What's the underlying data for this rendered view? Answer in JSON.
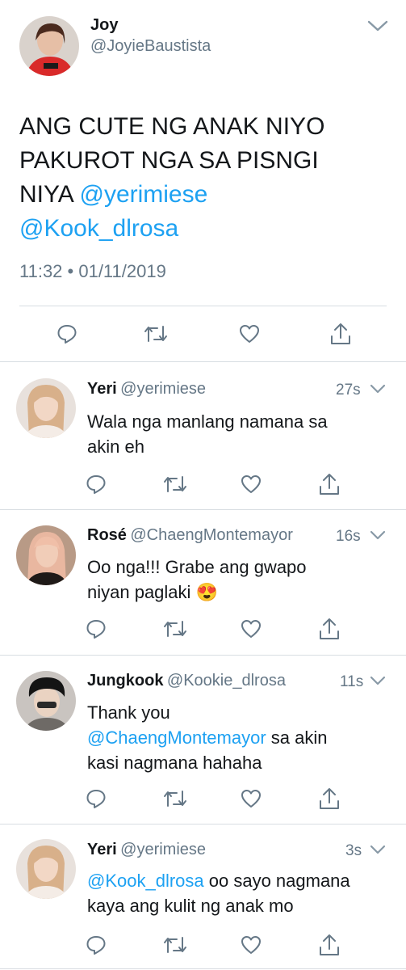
{
  "main_tweet": {
    "name": "Joy",
    "handle": "@JoyieBaustista",
    "text_line1": "ANG CUTE NG ANAK NIYO",
    "text_line2": "PAKUROT NGA SA PISNGI",
    "text_line3_prefix": "NIYA ",
    "mention1": "@yerimiese",
    "mention2": "@Kook_dlrosa",
    "timestamp": "11:32 • 01/11/2019"
  },
  "replies": [
    {
      "name": "Yeri",
      "handle": "@yerimiese",
      "time": "27s",
      "line1": "Wala nga manlang namana sa",
      "line2": "akin eh"
    },
    {
      "name": "Rosé",
      "handle": "@ChaengMontemayor",
      "time": "16s",
      "line1": "Oo nga!!! Grabe ang gwapo",
      "line2": "niyan paglaki",
      "emoji": "😍"
    },
    {
      "name": "Jungkook",
      "handle": "@Kookie_dlrosa",
      "time": "11s",
      "line1": "Thank you",
      "mention": "@ChaengMontemayor",
      "line2_suffix": " sa akin",
      "line3": "kasi nagmana hahaha"
    },
    {
      "name": "Yeri",
      "handle": "@yerimiese",
      "time": "3s",
      "mention": "@Kook_dlrosa",
      "line1_suffix": " oo sayo nagmana",
      "line2": "kaya ang kulit ng anak mo"
    }
  ],
  "icons": {
    "reply": "reply-icon",
    "retweet": "retweet-icon",
    "like": "like-icon",
    "share": "share-icon",
    "chevron": "chevron-down-icon"
  },
  "colors": {
    "link": "#1da1f2",
    "secondary": "#657786",
    "divider": "#d8dde2"
  }
}
